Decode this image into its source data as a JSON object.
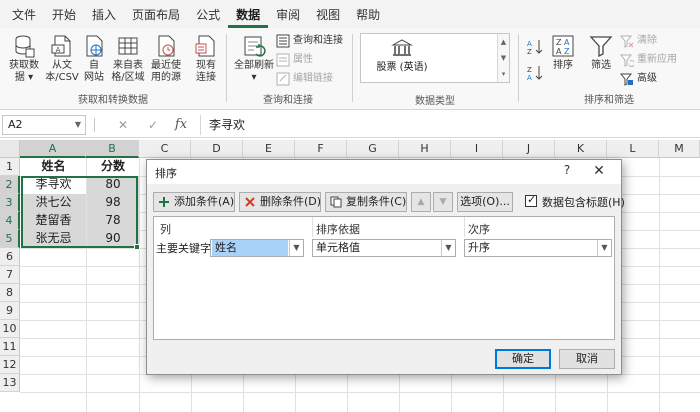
{
  "tabs": [
    "文件",
    "开始",
    "插入",
    "页面布局",
    "公式",
    "数据",
    "审阅",
    "视图",
    "帮助"
  ],
  "active_tab": "数据",
  "ribbon": {
    "get_transform": {
      "label": "获取和转换数据",
      "get_data": [
        "获取数",
        "据 ▾"
      ],
      "from_text": [
        "从文",
        "本/CSV"
      ],
      "from_web": [
        "自",
        "网站"
      ],
      "from_table": [
        "来自表",
        "格/区域"
      ],
      "recent_sources": [
        "最近使",
        "用的源"
      ],
      "existing_conn": [
        "现有",
        "连接"
      ]
    },
    "queries": {
      "label": "查询和连接",
      "refresh_all": [
        "全部刷新",
        "▾"
      ],
      "queries_conn": "查询和连接",
      "properties": "属性",
      "edit_links": "编辑链接"
    },
    "data_types": {
      "label": "数据类型",
      "stocks": "股票 (英语)"
    },
    "sort_filter": {
      "label": "排序和筛选",
      "sort": "排序",
      "filter": "筛选",
      "clear": "清除",
      "reapply": "重新应用",
      "advanced": "高级"
    }
  },
  "formula_bar": {
    "name_box": "A2",
    "content": "李寻欢"
  },
  "columns": [
    "A",
    "B",
    "C",
    "D",
    "E",
    "F",
    "G",
    "H",
    "I",
    "J",
    "K",
    "L",
    "M"
  ],
  "rows": [
    "1",
    "2",
    "3",
    "4",
    "5",
    "6",
    "7",
    "8",
    "9",
    "10",
    "11",
    "12",
    "13"
  ],
  "sheet": {
    "header": [
      "姓名",
      "分数"
    ],
    "data": [
      [
        "李寻欢",
        "80"
      ],
      [
        "洪七公",
        "98"
      ],
      [
        "楚留香",
        "78"
      ],
      [
        "张无忌",
        "90"
      ]
    ]
  },
  "sort_dialog": {
    "title": "排序",
    "help": "?",
    "close": "✕",
    "add_level": "添加条件(A)",
    "delete_level": "删除条件(D)",
    "copy_level": "复制条件(C)",
    "up_arrow": "▲",
    "down_arrow": "▼",
    "options": "选项(O)...",
    "has_headers": "数据包含标题(H)",
    "col_header": "列",
    "sort_on_header": "排序依据",
    "order_header": "次序",
    "row_label": "主要关键字",
    "sort_by_value": "姓名",
    "sort_on_value": "单元格值",
    "order_value": "升序",
    "ok": "确定",
    "cancel": "取消"
  }
}
